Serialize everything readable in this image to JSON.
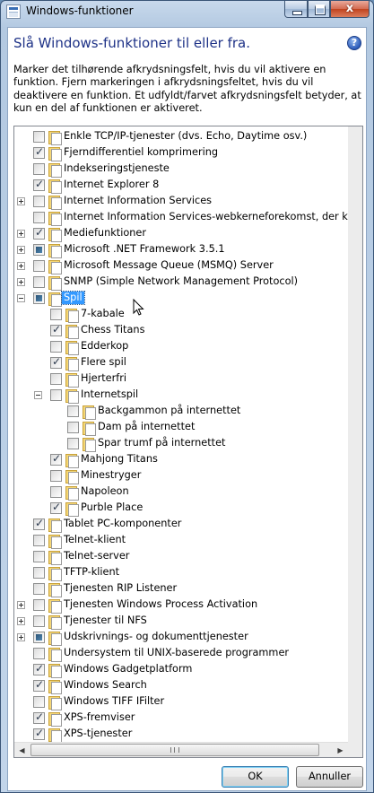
{
  "window": {
    "title": "Windows-funktioner",
    "close_glyph": "x"
  },
  "header": {
    "heading": "Slå Windows-funktioner til eller fra.",
    "help_glyph": "?",
    "description": "Marker det tilhørende afkrydsningsfelt, hvis du vil aktivere en funktion. Fjern markeringen i afkrydsningsfeltet, hvis du vil deaktivere en funktion. Et udfyldt/farvet afkrydsningsfelt betyder, at kun en del af funktionen er aktiveret."
  },
  "features": [
    {
      "label": "Enkle TCP/IP-tjenester (dvs. Echo, Daytime osv.)",
      "state": "off",
      "level": 0,
      "expander": "none"
    },
    {
      "label": "Fjerndifferentiel komprimering",
      "state": "on",
      "level": 0,
      "expander": "none"
    },
    {
      "label": "Indekseringstjeneste",
      "state": "off",
      "level": 0,
      "expander": "none"
    },
    {
      "label": "Internet Explorer 8",
      "state": "on",
      "level": 0,
      "expander": "none"
    },
    {
      "label": "Internet Information Services",
      "state": "off",
      "level": 0,
      "expander": "plus"
    },
    {
      "label": "Internet Information Services-webkerneforekomst, der kan fung",
      "state": "off",
      "level": 0,
      "expander": "none"
    },
    {
      "label": "Mediefunktioner",
      "state": "on",
      "level": 0,
      "expander": "plus"
    },
    {
      "label": "Microsoft .NET Framework 3.5.1",
      "state": "partial",
      "level": 0,
      "expander": "plus"
    },
    {
      "label": "Microsoft Message Queue (MSMQ) Server",
      "state": "off",
      "level": 0,
      "expander": "plus"
    },
    {
      "label": "SNMP (Simple Network Management Protocol)",
      "state": "off",
      "level": 0,
      "expander": "plus"
    },
    {
      "label": "Spil",
      "state": "partial",
      "level": 0,
      "expander": "minus",
      "selected": true
    },
    {
      "label": "7-kabale",
      "state": "off",
      "level": 1,
      "expander": "none"
    },
    {
      "label": "Chess Titans",
      "state": "on",
      "level": 1,
      "expander": "none"
    },
    {
      "label": "Edderkop",
      "state": "off",
      "level": 1,
      "expander": "none"
    },
    {
      "label": "Flere spil",
      "state": "on",
      "level": 1,
      "expander": "none"
    },
    {
      "label": "Hjerterfri",
      "state": "off",
      "level": 1,
      "expander": "none"
    },
    {
      "label": "Internetspil",
      "state": "off",
      "level": 1,
      "expander": "minus"
    },
    {
      "label": "Backgammon på internettet",
      "state": "off",
      "level": 2,
      "expander": "none"
    },
    {
      "label": "Dam på internettet",
      "state": "off",
      "level": 2,
      "expander": "none"
    },
    {
      "label": "Spar trumf på internettet",
      "state": "off",
      "level": 2,
      "expander": "none"
    },
    {
      "label": "Mahjong Titans",
      "state": "on",
      "level": 1,
      "expander": "none"
    },
    {
      "label": "Minestryger",
      "state": "off",
      "level": 1,
      "expander": "none"
    },
    {
      "label": "Napoleon",
      "state": "off",
      "level": 1,
      "expander": "none"
    },
    {
      "label": "Purble Place",
      "state": "on",
      "level": 1,
      "expander": "none"
    },
    {
      "label": "Tablet PC-komponenter",
      "state": "on",
      "level": 0,
      "expander": "none"
    },
    {
      "label": "Telnet-klient",
      "state": "off",
      "level": 0,
      "expander": "none"
    },
    {
      "label": "Telnet-server",
      "state": "off",
      "level": 0,
      "expander": "none"
    },
    {
      "label": "TFTP-klient",
      "state": "off",
      "level": 0,
      "expander": "none"
    },
    {
      "label": "Tjenesten RIP Listener",
      "state": "off",
      "level": 0,
      "expander": "none"
    },
    {
      "label": "Tjenesten Windows Process Activation",
      "state": "off",
      "level": 0,
      "expander": "plus"
    },
    {
      "label": "Tjenester til NFS",
      "state": "off",
      "level": 0,
      "expander": "plus"
    },
    {
      "label": "Udskrivnings- og dokumenttjenester",
      "state": "partial",
      "level": 0,
      "expander": "plus"
    },
    {
      "label": "Undersystem til UNIX-baserede programmer",
      "state": "off",
      "level": 0,
      "expander": "none"
    },
    {
      "label": "Windows Gadgetplatform",
      "state": "on",
      "level": 0,
      "expander": "none"
    },
    {
      "label": "Windows Search",
      "state": "on",
      "level": 0,
      "expander": "none"
    },
    {
      "label": "Windows TIFF IFilter",
      "state": "off",
      "level": 0,
      "expander": "none"
    },
    {
      "label": "XPS-fremviser",
      "state": "on",
      "level": 0,
      "expander": "none"
    },
    {
      "label": "XPS-tjenester",
      "state": "on",
      "level": 0,
      "expander": "none"
    }
  ],
  "scrollbar": {
    "left_arrow": "◀",
    "right_arrow": "▶"
  },
  "buttons": {
    "ok": "OK",
    "cancel": "Annuller"
  }
}
